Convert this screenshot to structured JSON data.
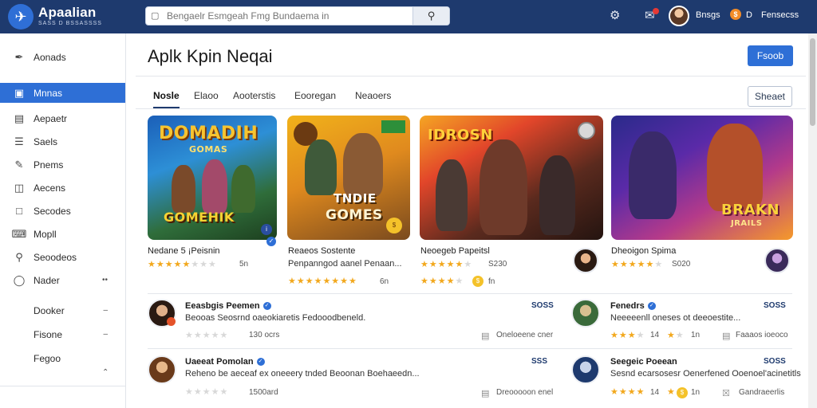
{
  "header": {
    "brand_name": "Apaalian",
    "brand_sub": "SASS D BSSASSSS",
    "search_placeholder": "Bengaelr Esmgeah Fmg Bundaema in",
    "user_name": "Bnsgs",
    "coin_count": "D",
    "account_label": "Fensecss"
  },
  "sidebar": {
    "items": [
      {
        "label": "Aonads"
      },
      {
        "label": "Mnnas"
      },
      {
        "label": "Aepaetr"
      },
      {
        "label": "Saels"
      },
      {
        "label": "Pnems"
      },
      {
        "label": "Aecens"
      },
      {
        "label": "Secodes"
      },
      {
        "label": "Mopll"
      },
      {
        "label": "Seoodeos"
      },
      {
        "label": "Nader"
      },
      {
        "label": "Dooker"
      },
      {
        "label": "Fisone"
      },
      {
        "label": "Fegoo"
      }
    ]
  },
  "main": {
    "title": "Aplk Kpin Neqai",
    "primary_button": "Fsoob",
    "outline_button": "Sheaet",
    "tabs": [
      {
        "label": "Nosle"
      },
      {
        "label": "Elaoo"
      },
      {
        "label": "Aooterstis"
      },
      {
        "label": "Eooregan"
      },
      {
        "label": "Neaoers"
      }
    ]
  },
  "cards": [
    {
      "art_top": "DOMADIH",
      "art_mid": "GOMAS",
      "art_bottom": "GOMEHIK",
      "name": "Nedane 5 ¡Peisnin",
      "meta": "5n"
    },
    {
      "art_top": "TNDIE",
      "art_bottom": "GOMES",
      "name": "Reaeos Sostente",
      "sub": "Penpanngod aanel Penaan...",
      "meta": "6n"
    },
    {
      "art_top": "IDROSN",
      "name": "Neoegeb Papeitsl",
      "meta": "fn",
      "meta2": "S230"
    },
    {
      "art_top": "BRAKN",
      "art_bottom": "JRAILS",
      "name": "Dheoigon Spima",
      "meta": "S020"
    }
  ],
  "rows": [
    {
      "left": {
        "title": "Eeasbgis Peemen",
        "desc": "Beooas Seosrnd oaeokiaretis Fedooodbeneld.",
        "count": "130 ocrs",
        "right": "Oneloeene cner",
        "date": "SOSS"
      },
      "right": {
        "title": "Fenedrs",
        "desc": "Neeeeenll oneses ot deeoestite...",
        "meta": "1n",
        "meta_num": "14",
        "right": "Faaaos ioeoco",
        "date": "SOSS"
      }
    },
    {
      "left": {
        "title": "Uaeeat Pomolan",
        "desc": "Reheno be aeceaf ex oneeery tnded Beoonan Boehaeedn...",
        "count": "1500ard",
        "right": "Dreooooon enel",
        "date": "SSS"
      },
      "right": {
        "title": "Seegeic Poeean",
        "desc": "Sesnd ecarsosesr Oenerfened Ooenoel'acinetitls",
        "meta": "1n",
        "meta_num": "14",
        "right": "Gandraeerlis",
        "date": "SOSS"
      }
    }
  ],
  "colors": {
    "header_bg": "#1e3a6e",
    "accent": "#2e6fd6",
    "star": "#f2a81d"
  }
}
